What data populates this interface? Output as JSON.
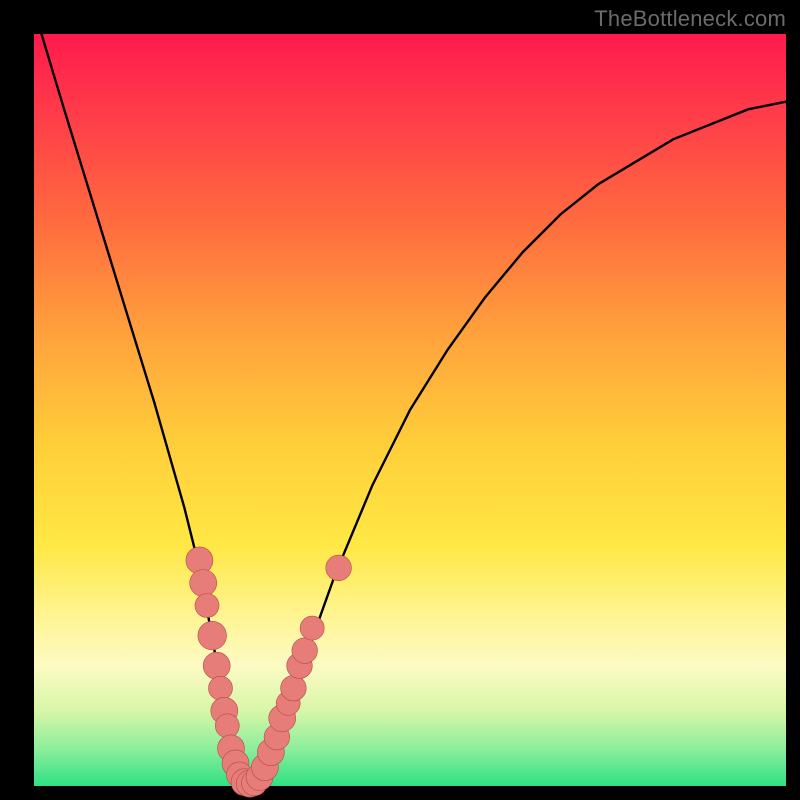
{
  "watermark": "TheBottleneck.com",
  "colors": {
    "frame": "#000000",
    "gradient_top": "#ff1a4d",
    "gradient_bottom": "#2fe084",
    "curve": "#000000",
    "marker_fill": "#e77d78",
    "marker_stroke": "#b34b47"
  },
  "chart_data": {
    "type": "line",
    "title": "",
    "xlabel": "",
    "ylabel": "",
    "xlim": [
      0,
      100
    ],
    "ylim": [
      0,
      100
    ],
    "grid": false,
    "legend": false,
    "series": [
      {
        "name": "bottleneck-curve",
        "x": [
          1,
          4,
          8,
          12,
          16,
          20,
          22,
          24,
          25,
          26,
          27,
          28,
          29,
          30,
          32,
          35,
          40,
          45,
          50,
          55,
          60,
          65,
          70,
          75,
          80,
          85,
          90,
          95,
          100
        ],
        "y": [
          100,
          90,
          77,
          64,
          51,
          37,
          29,
          18,
          11,
          5,
          1,
          0,
          0,
          1,
          5,
          14,
          28,
          40,
          50,
          58,
          65,
          71,
          76,
          80,
          83,
          86,
          88,
          90,
          91
        ]
      }
    ],
    "markers": [
      {
        "x": 22.0,
        "y": 30,
        "r": 1.8
      },
      {
        "x": 22.5,
        "y": 27,
        "r": 1.8
      },
      {
        "x": 23.0,
        "y": 24,
        "r": 1.6
      },
      {
        "x": 23.7,
        "y": 20,
        "r": 1.9
      },
      {
        "x": 24.3,
        "y": 16,
        "r": 1.8
      },
      {
        "x": 24.8,
        "y": 13,
        "r": 1.6
      },
      {
        "x": 25.3,
        "y": 10,
        "r": 1.8
      },
      {
        "x": 25.7,
        "y": 8,
        "r": 1.6
      },
      {
        "x": 26.2,
        "y": 5,
        "r": 1.8
      },
      {
        "x": 26.8,
        "y": 3,
        "r": 1.8
      },
      {
        "x": 27.3,
        "y": 1.5,
        "r": 1.7
      },
      {
        "x": 28.0,
        "y": 0.5,
        "r": 1.8
      },
      {
        "x": 28.7,
        "y": 0.3,
        "r": 1.8
      },
      {
        "x": 29.3,
        "y": 0.4,
        "r": 1.7
      },
      {
        "x": 30.0,
        "y": 1.2,
        "r": 1.8
      },
      {
        "x": 30.7,
        "y": 2.5,
        "r": 1.8
      },
      {
        "x": 31.5,
        "y": 4.5,
        "r": 1.8
      },
      {
        "x": 32.3,
        "y": 6.5,
        "r": 1.7
      },
      {
        "x": 33.0,
        "y": 9,
        "r": 1.8
      },
      {
        "x": 33.8,
        "y": 11,
        "r": 1.6
      },
      {
        "x": 34.5,
        "y": 13,
        "r": 1.7
      },
      {
        "x": 35.3,
        "y": 16,
        "r": 1.7
      },
      {
        "x": 36.0,
        "y": 18,
        "r": 1.7
      },
      {
        "x": 37.0,
        "y": 21,
        "r": 1.6
      },
      {
        "x": 40.5,
        "y": 29,
        "r": 1.7
      }
    ]
  }
}
